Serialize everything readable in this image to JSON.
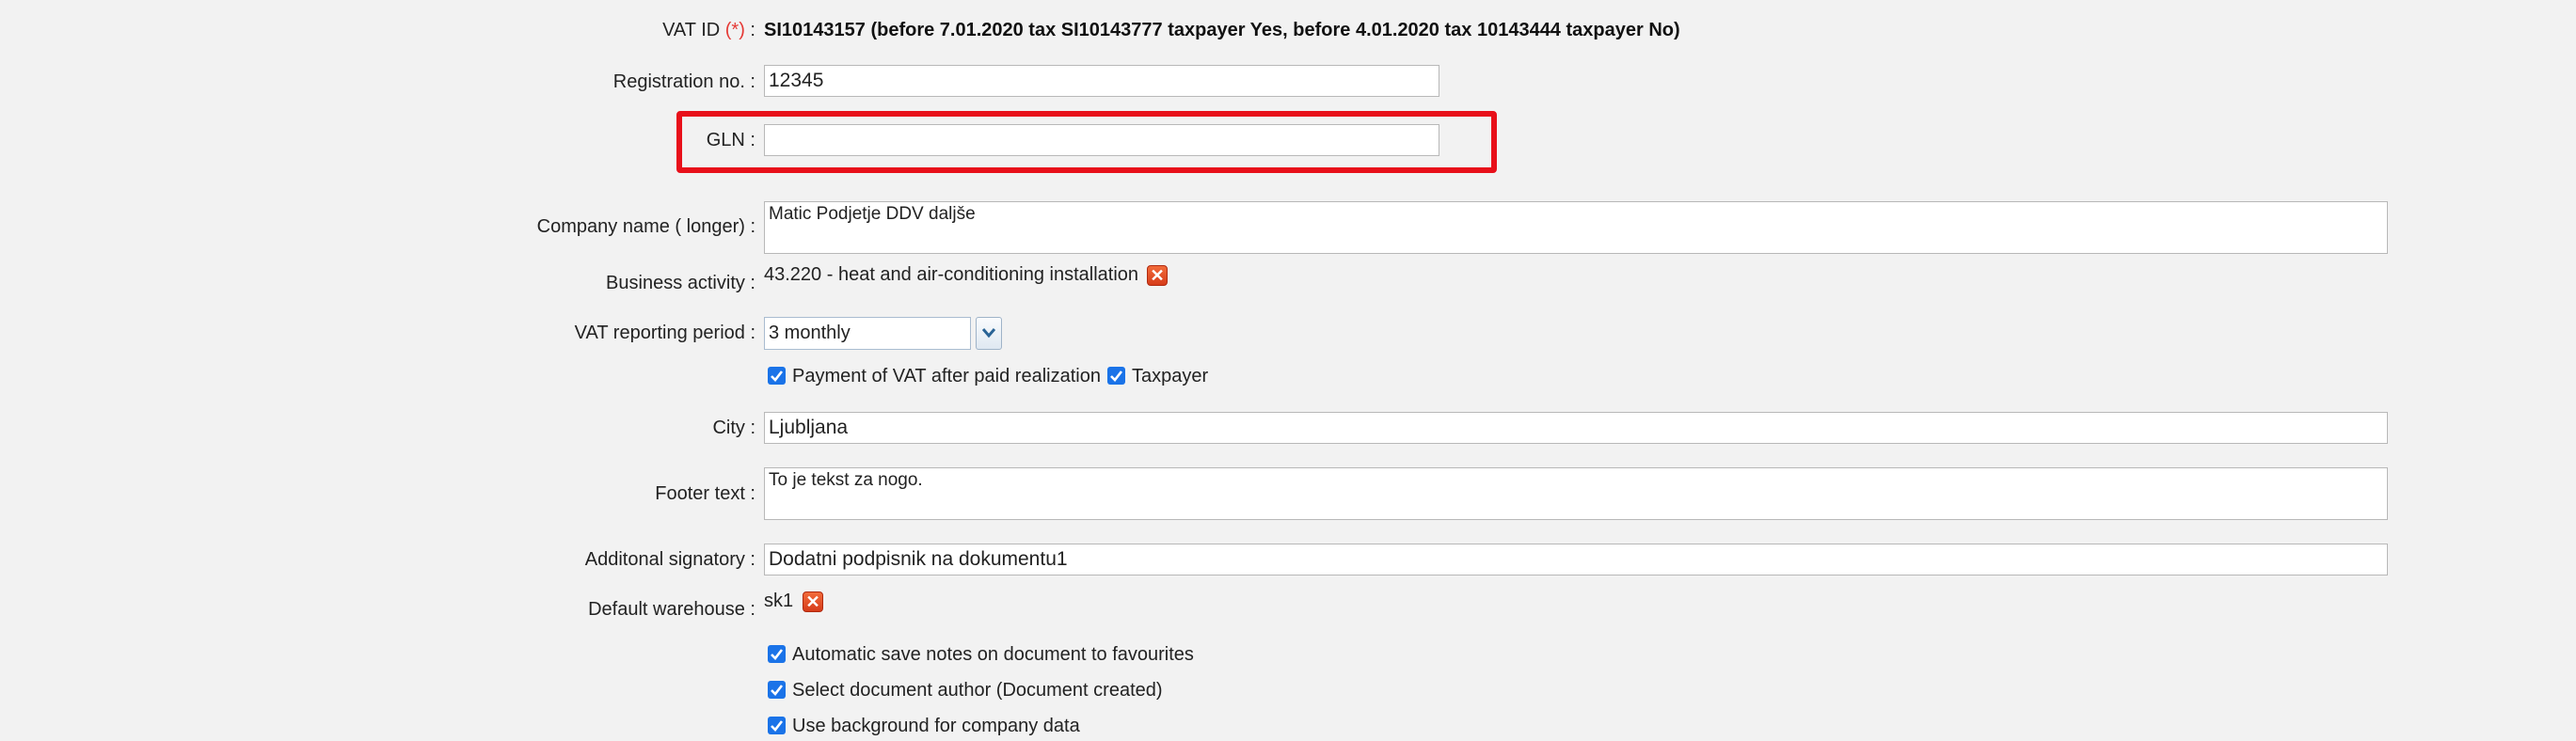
{
  "vat_id": {
    "label": "VAT ID",
    "required_mark": "(*)",
    "colon": " :",
    "value": "SI10143157 (before 7.01.2020 tax SI10143777 taxpayer Yes, before 4.01.2020 tax 10143444 taxpayer No)"
  },
  "registration_no": {
    "label": "Registration no. :",
    "value": "12345"
  },
  "gln": {
    "label": "GLN :",
    "value": ""
  },
  "company_name_longer": {
    "label": "Company name ( longer) :",
    "value": "Matic Podjetje DDV daljše"
  },
  "business_activity": {
    "label": "Business activity :",
    "value": "43.220 - heat and air-conditioning installation",
    "remove_icon": "remove-icon"
  },
  "vat_reporting_period": {
    "label": "VAT reporting period :",
    "selected": "3 monthly",
    "dropdown_icon": "chevron-down-icon"
  },
  "payment_after_realization": {
    "label": "Payment of VAT after paid realization",
    "checked": true
  },
  "taxpayer": {
    "label": "Taxpayer",
    "checked": true
  },
  "city": {
    "label": "City :",
    "value": "Ljubljana"
  },
  "footer_text": {
    "label": "Footer text :",
    "value": "To je tekst za nogo."
  },
  "additional_signatory": {
    "label": "Additonal signatory :",
    "value": "Dodatni podpisnik na dokumentu1"
  },
  "default_warehouse": {
    "label": "Default warehouse :",
    "value": "sk1",
    "remove_icon": "remove-icon"
  },
  "options": [
    {
      "label": "Automatic save notes on document to favourites",
      "checked": true
    },
    {
      "label": "Select document author (Document created)",
      "checked": true
    },
    {
      "label": "Use background for company data",
      "checked": true
    }
  ],
  "colors": {
    "highlight": "#e8101a",
    "required": "#e53935",
    "checkbox": "#1a73e8",
    "remove_icon": "#e0492a"
  }
}
